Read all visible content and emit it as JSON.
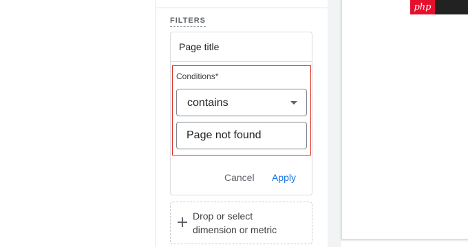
{
  "filters": {
    "heading": "FILTERS",
    "card": {
      "title": "Page title",
      "conditions_label": "Conditions*",
      "operator": "contains",
      "value": "Page not found",
      "cancel_label": "Cancel",
      "apply_label": "Apply"
    },
    "drop_zone": {
      "line1": "Drop or select",
      "line2": "dimension or metric"
    }
  },
  "watermark": {
    "text": "php"
  },
  "colors": {
    "accent": "#1a73e8",
    "highlight_border": "#d93025",
    "watermark_red": "#e4102d"
  },
  "icons": [
    "chevron-down-icon",
    "plus-icon"
  ]
}
